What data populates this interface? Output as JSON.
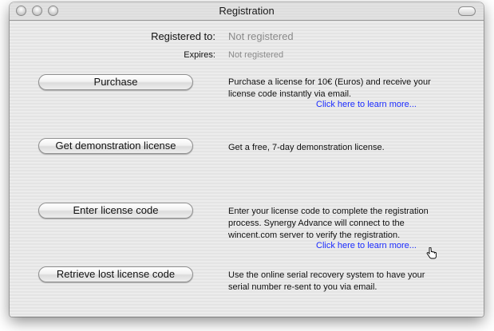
{
  "window": {
    "title": "Registration"
  },
  "info": {
    "registered_label": "Registered to:",
    "registered_value": "Not registered",
    "expires_label": "Expires:",
    "expires_value": "Not registered"
  },
  "rows": [
    {
      "button": "Purchase",
      "desc": [
        "Purchase a license for 10€ (Euros) and receive your",
        "license code instantly via email."
      ],
      "link": "Click here to learn more..."
    },
    {
      "button": "Get demonstration license",
      "desc": [
        "Get a free, 7-day demonstration license."
      ]
    },
    {
      "button": "Enter license code",
      "desc": [
        "Enter your license code to complete the registration",
        "process. Synergy Advance will connect to the",
        "wincent.com server to verify the registration."
      ],
      "link": "Click here to learn more..."
    },
    {
      "button": "Retrieve lost license code",
      "desc": [
        "Use the online serial recovery system to have your",
        "serial number re-sent to you via email."
      ]
    }
  ],
  "colors": {
    "link": "#1c2cff",
    "muted_value": "#8a8a8a"
  },
  "icons": {
    "cursor": "pointing-hand-cursor"
  }
}
